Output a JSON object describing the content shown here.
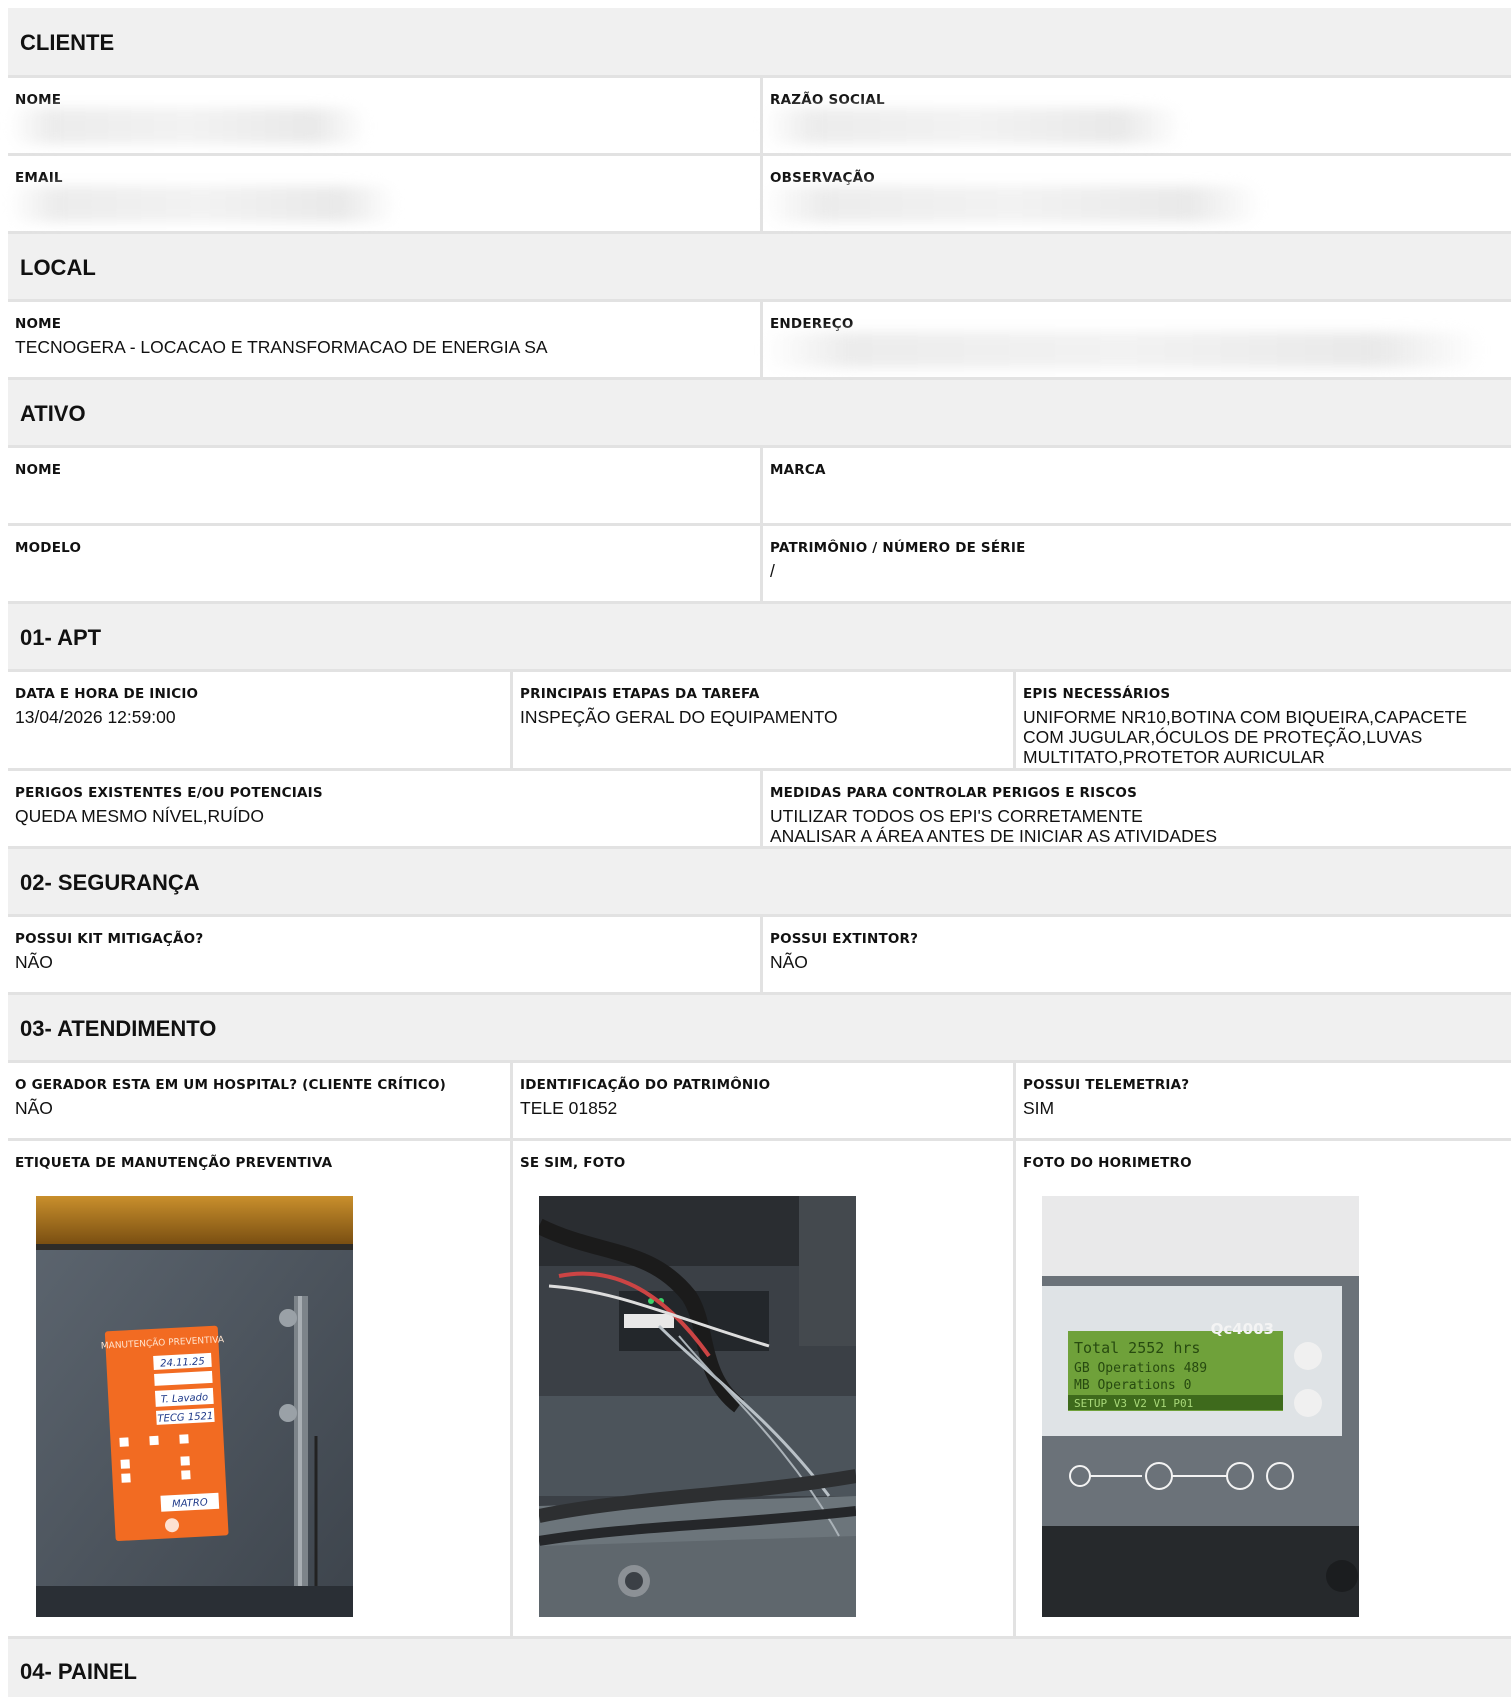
{
  "cliente": {
    "title": "CLIENTE",
    "nome_label": "NOME",
    "razao_label": "RAZÃO SOCIAL",
    "email_label": "EMAIL",
    "obs_label": "OBSERVAÇÃO"
  },
  "local": {
    "title": "LOCAL",
    "nome_label": "NOME",
    "nome_value": "TECNOGERA - LOCACAO E TRANSFORMACAO DE ENERGIA SA",
    "endereco_label": "ENDEREÇO"
  },
  "ativo": {
    "title": "ATIVO",
    "nome_label": "NOME",
    "marca_label": "MARCA",
    "modelo_label": "MODELO",
    "patrimonio_label": "PATRIMÔNIO / NÚMERO DE SÉRIE",
    "patrimonio_value": "/"
  },
  "apt": {
    "title": "01- APT",
    "inicio_label": "DATA E HORA DE INICIO",
    "inicio_value": "13/04/2026 12:59:00",
    "etapas_label": "PRINCIPAIS ETAPAS DA TAREFA",
    "etapas_value": "INSPEÇÃO GERAL DO EQUIPAMENTO",
    "epis_label": "EPIS NECESSÁRIOS",
    "epis_value": "UNIFORME NR10,BOTINA COM BIQUEIRA,CAPACETE COM JUGULAR,ÓCULOS DE PROTEÇÃO,LUVAS MULTITATO,PROTETOR AURICULAR",
    "perigos_label": "PERIGOS EXISTENTES E/OU POTENCIAIS",
    "perigos_value": "QUEDA MESMO NÍVEL,RUÍDO",
    "medidas_label": "MEDIDAS PARA CONTROLAR PERIGOS E RISCOS",
    "medidas_value": "UTILIZAR TODOS OS EPI'S CORRETAMENTE\nANALISAR A ÁREA ANTES DE INICIAR AS ATIVIDADES"
  },
  "seguranca": {
    "title": "02- SEGURANÇA",
    "kit_label": "POSSUI KIT MITIGAÇÃO?",
    "kit_value": "NÃO",
    "extintor_label": "POSSUI EXTINTOR?",
    "extintor_value": "NÃO"
  },
  "atendimento": {
    "title": "03- ATENDIMENTO",
    "hospital_label": "O GERADOR ESTA EM UM HOSPITAL? (CLIENTE CRÍTICO)",
    "hospital_value": "NÃO",
    "ident_label": "IDENTIFICAÇÃO DO PATRIMÔNIO",
    "ident_value": "TELE 01852",
    "telemetria_label": "POSSUI TELEMETRIA?",
    "telemetria_value": "SIM",
    "etiqueta_label": "ETIQUETA DE MANUTENÇÃO PREVENTIVA",
    "foto_label": "SE SIM, FOTO",
    "horimetro_label": "FOTO DO HORIMETRO",
    "tag": {
      "title": "MANUTENÇÃO PREVENTIVA",
      "date": "24.11.25",
      "exec": "T. Lavado",
      "patr": "TECG 1521",
      "resp": "MATRO"
    },
    "display": {
      "model": "Qc4003",
      "row1": "Total    2552 hrs",
      "row2": "GB Operations  489",
      "row3": "MB Operations    0",
      "row4": "SETUP V3 V2 V1  P01"
    }
  },
  "painel": {
    "title": "04- PAINEL"
  }
}
